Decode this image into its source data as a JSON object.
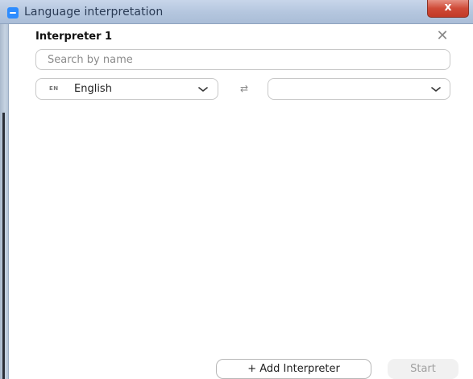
{
  "window": {
    "title": "Language interpretation",
    "close_glyph": "x"
  },
  "panel": {
    "heading": "Interpreter 1",
    "close_icon": "close-icon"
  },
  "search": {
    "placeholder": "Search by name",
    "value": ""
  },
  "languages": {
    "from": {
      "code": "EN",
      "name": "English"
    },
    "to": {
      "code": "",
      "name": ""
    },
    "swap_icon": "swap-arrows-icon"
  },
  "footer": {
    "add_label": "+ Add Interpreter",
    "start_label": "Start"
  },
  "colors": {
    "accent": "#2d8cff",
    "close_button": "#cf4a37",
    "disabled_text": "#a0a0a0"
  }
}
